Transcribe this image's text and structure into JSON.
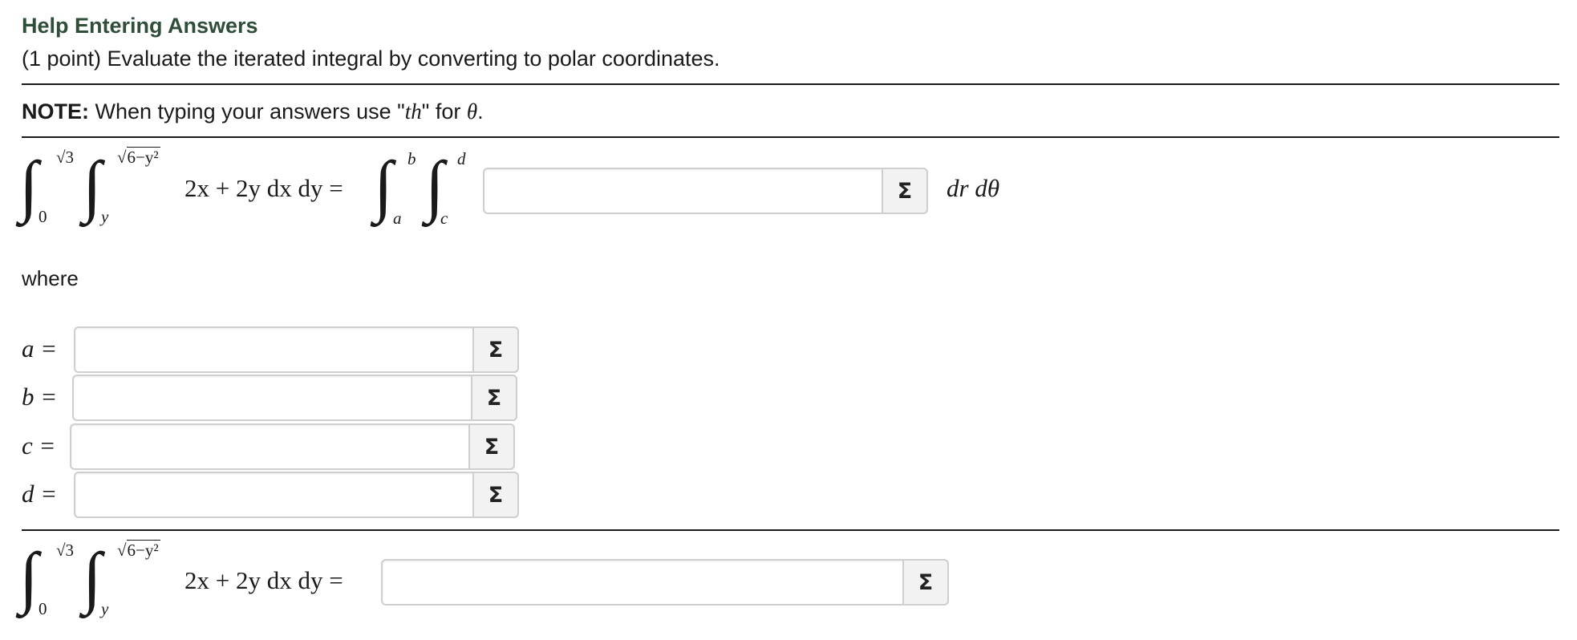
{
  "header": {
    "help_link": "Help Entering Answers",
    "prompt": "(1 point) Evaluate the iterated integral by converting to polar coordinates."
  },
  "note": {
    "label": "NOTE:",
    "text_before": " When typing your answers use \"",
    "code": "th",
    "text_after": "\" for ",
    "theta": "θ",
    "period": "."
  },
  "integral": {
    "outer_lower": "0",
    "outer_upper": "√3",
    "inner_lower": "y",
    "inner_upper_root": "√",
    "inner_upper_radicand": "6−y²",
    "integrand": "2x + 2y dx dy =",
    "polar_outer_lower": "a",
    "polar_outer_upper": "b",
    "polar_inner_lower": "c",
    "polar_inner_upper": "d",
    "polar_differential": "dr dθ"
  },
  "where_text": "where",
  "variables": [
    {
      "label": "a =",
      "value": ""
    },
    {
      "label": "b =",
      "value": ""
    },
    {
      "label": "c =",
      "value": ""
    },
    {
      "label": "d =",
      "value": ""
    }
  ],
  "answers": {
    "integrand_value": "",
    "final_value": ""
  },
  "icons": {
    "sigma_glyph": "Σ",
    "sigma_icon_name": "sigma-icon"
  },
  "colors": {
    "link": "#2f4e3a",
    "input_border": "#cfcfcf",
    "button_bg": "#f2f2f2"
  }
}
